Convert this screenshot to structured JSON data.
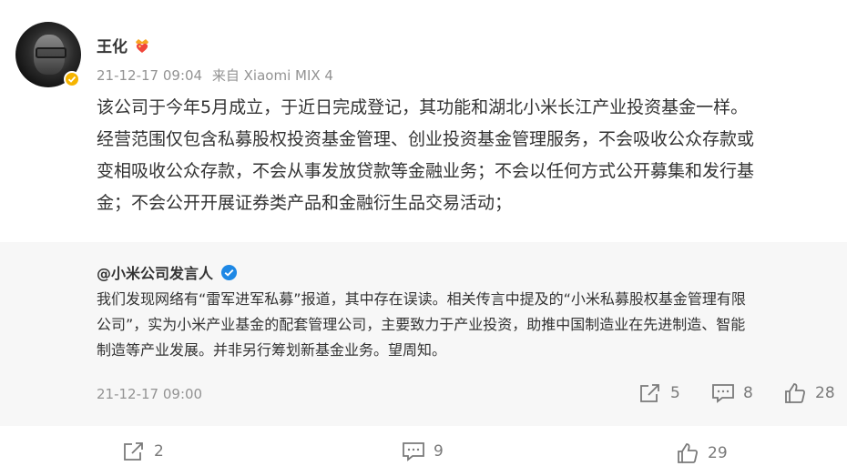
{
  "post": {
    "author": "王化",
    "timestamp": "21-12-17 09:04",
    "source": "来自 Xiaomi MIX 4",
    "text_lines": [
      "该公司于今年5月成立，于近日完成登记，其功能和湖北小米长江产业投资基金一样。",
      "经营范围仅包含私募股权投资基金管理、创业投资基金管理服务，不会吸收公众存款或",
      "变相吸收公众存款，不会从事发放贷款等金融业务；不会以任何方式公开募集和发行基",
      "金；不会公开开展证券类产品和金融衍生品交易活动；"
    ],
    "reposts": "2",
    "comments": "9",
    "likes": "29"
  },
  "repost": {
    "author": "@小米公司发言人",
    "text_lines": [
      "我们发现网络有“雷军进军私募”报道，其中存在误读。相关传言中提及的“小米私募股权基金管理有限",
      "公司”，实为小米产业基金的配套管理公司，主要致力于产业投资，助推中国制造业在先进制造、智能",
      "制造等产业发展。并非另行筹划新基金业务。望周知。"
    ],
    "timestamp": "21-12-17 09:00",
    "reposts": "5",
    "comments": "8",
    "likes": "28"
  },
  "icons": {
    "verified_badge": "orange-check-icon",
    "vip_badge": "heart-crown-icon",
    "official_badge": "blue-check-icon",
    "repost": "share-arrow-icon",
    "comment": "comment-bubble-icon",
    "like": "thumb-up-icon"
  },
  "colors": {
    "meta_gray": "#939393",
    "verified_orange": "#f5b400",
    "official_blue": "#1e88e5",
    "repost_bg": "#f7f7f7"
  }
}
